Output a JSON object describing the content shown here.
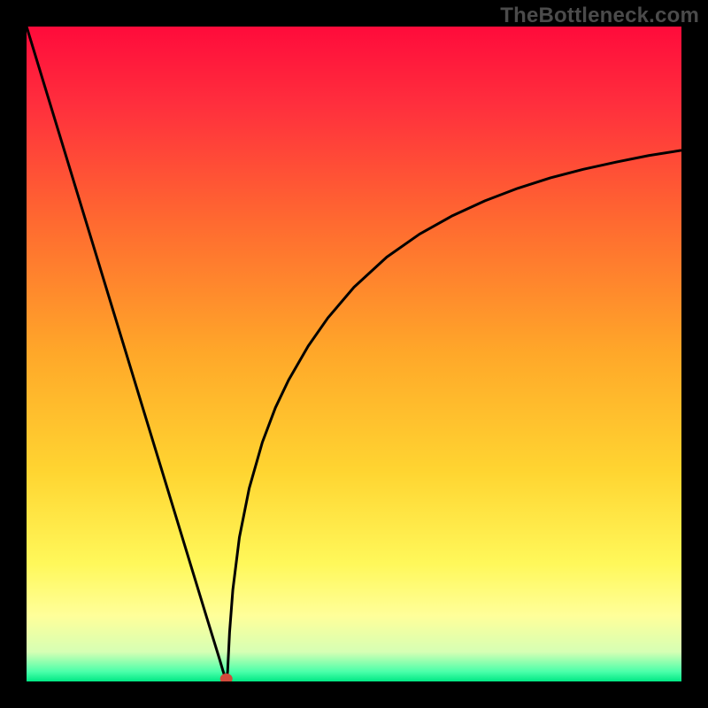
{
  "watermark": "TheBottleneck.com",
  "chart_data": {
    "type": "line",
    "title": "",
    "xlabel": "",
    "ylabel": "",
    "xlim": [
      0,
      1
    ],
    "ylim": [
      0,
      1
    ],
    "background_gradient": {
      "stops": [
        {
          "offset": 0.0,
          "color": "#ff0b3b"
        },
        {
          "offset": 0.12,
          "color": "#ff2f3d"
        },
        {
          "offset": 0.3,
          "color": "#ff6a30"
        },
        {
          "offset": 0.5,
          "color": "#ffa829"
        },
        {
          "offset": 0.68,
          "color": "#ffd531"
        },
        {
          "offset": 0.82,
          "color": "#fff85a"
        },
        {
          "offset": 0.9,
          "color": "#ffff9a"
        },
        {
          "offset": 0.955,
          "color": "#d6ffb4"
        },
        {
          "offset": 0.985,
          "color": "#4bffaa"
        },
        {
          "offset": 1.0,
          "color": "#00e884"
        }
      ]
    },
    "curve_generation": {
      "comment": "V-shaped bottleneck curve. y computed from x with a sharp min at x_min, linear left branch and sqrt-like right branch.",
      "x_min": 0.305,
      "left": {
        "x0": 0.0,
        "y0": 1.0
      },
      "right": {
        "asymptote_y": 0.83,
        "shape_k": 0.055
      }
    },
    "min_marker": {
      "x": 0.305,
      "y": 0.0,
      "color": "#d24a3c",
      "rx": 7,
      "ry": 6
    },
    "series": [
      {
        "name": "bottleneck-curve",
        "color": "#000000",
        "stroke_width": 3,
        "x": [
          0.0,
          0.025,
          0.05,
          0.075,
          0.1,
          0.125,
          0.15,
          0.175,
          0.2,
          0.225,
          0.25,
          0.275,
          0.295,
          0.3,
          0.303,
          0.305,
          0.307,
          0.31,
          0.315,
          0.325,
          0.34,
          0.36,
          0.38,
          0.4,
          0.43,
          0.46,
          0.5,
          0.55,
          0.6,
          0.65,
          0.7,
          0.75,
          0.8,
          0.85,
          0.9,
          0.95,
          1.0
        ],
        "y": [
          1.0,
          0.918,
          0.836,
          0.754,
          0.672,
          0.59,
          0.508,
          0.426,
          0.344,
          0.262,
          0.18,
          0.098,
          0.033,
          0.016,
          0.007,
          0.0,
          0.015,
          0.075,
          0.14,
          0.22,
          0.295,
          0.365,
          0.418,
          0.46,
          0.512,
          0.555,
          0.602,
          0.648,
          0.683,
          0.711,
          0.734,
          0.753,
          0.769,
          0.782,
          0.793,
          0.803,
          0.811
        ]
      }
    ]
  }
}
